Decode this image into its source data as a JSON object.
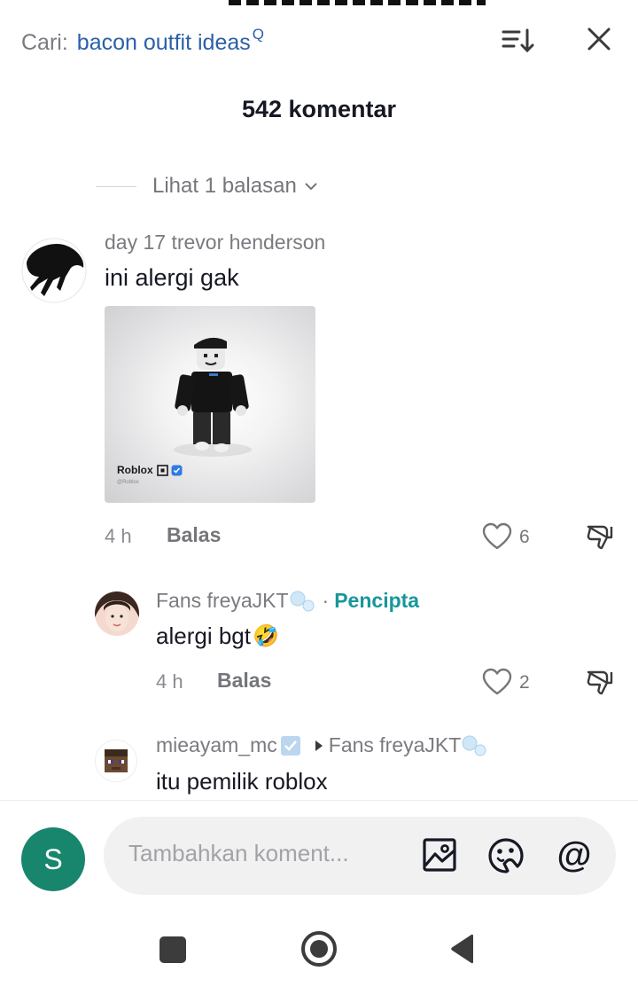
{
  "header": {
    "search_prefix": "Cari:",
    "search_query": "bacon outfit ideas",
    "search_icon": "Q",
    "sort_icon": "sort-icon",
    "close_icon": "close-icon",
    "title": "542 komentar"
  },
  "view_replies": {
    "label": "Lihat 1 balasan"
  },
  "comments": [
    {
      "username": "day 17 trevor henderson",
      "text": "ini alergi gak",
      "image": {
        "brand_label": "Roblox",
        "brand_sub": "@Roblox"
      },
      "time": "4 h",
      "reply_label": "Balas",
      "likes": "6"
    }
  ],
  "replies": [
    {
      "username": "Fans freyaJKT",
      "separator": "·",
      "creator_badge": "Pencipta",
      "text": "alergi bgt",
      "emoji": "🤣",
      "time": "4 h",
      "reply_label": "Balas",
      "likes": "2"
    },
    {
      "username": "mieayam_mc",
      "reply_to": "Fans freyaJKT",
      "text": "itu pemilik roblox"
    }
  ],
  "composer": {
    "user_initial": "S",
    "placeholder": "Tambahkan koment...",
    "at_symbol": "@"
  },
  "colors": {
    "link_blue": "#2b5fa8",
    "creator_teal": "#18969b",
    "avatar_green": "#17866c",
    "muted_text": "#75767a"
  }
}
